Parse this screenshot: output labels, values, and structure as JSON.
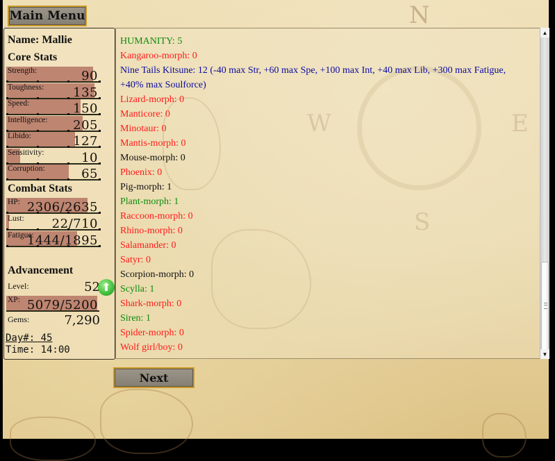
{
  "buttons": {
    "main_menu": "Main Menu",
    "next": "Next"
  },
  "compass": {
    "n": "N",
    "w": "W",
    "e": "E",
    "s": "S"
  },
  "player": {
    "name_label": "Name: Mallie"
  },
  "core_stats": {
    "heading": "Core Stats",
    "items": [
      {
        "label": "Strength:",
        "value": "90",
        "fill": 0.93
      },
      {
        "label": "Toughness:",
        "value": "135",
        "fill": 0.95
      },
      {
        "label": "Speed:",
        "value": "150",
        "fill": 0.8
      },
      {
        "label": "Intelligence:",
        "value": "205",
        "fill": 0.82
      },
      {
        "label": "Libido:",
        "value": "127",
        "fill": 0.74
      },
      {
        "label": "Sensitivity:",
        "value": "10",
        "fill": 0.15
      },
      {
        "label": "Corruption:",
        "value": "65",
        "fill": 0.67
      }
    ]
  },
  "combat_stats": {
    "heading": "Combat Stats",
    "items": [
      {
        "label": "HP:",
        "value": "2306/2635",
        "fill": 0.875
      },
      {
        "label": "Lust:",
        "value": "22/710",
        "fill": 0.03
      },
      {
        "label": "Fatigue:",
        "value": "1444/1895",
        "fill": 0.76
      }
    ]
  },
  "advancement": {
    "heading": "Advancement",
    "level_label": "Level:",
    "level_value": "52",
    "level_up_icon": "arrow-up",
    "xp_label": "XP:",
    "xp_value": "5079/5200",
    "xp_fill": 0.98,
    "gems_label": "Gems:",
    "gems_value": "7,290"
  },
  "time": {
    "day": "Day#: 45",
    "time": "Time: 14:00"
  },
  "colors": {
    "good": "#0d8b0d",
    "bad": "#ff1a1a",
    "info": "#0a0aa0",
    "neutral": "#111111",
    "bar_fill": "#b87b68"
  },
  "main_text": {
    "lines": [
      {
        "text": "HUMANITY: 5",
        "tone": "green"
      },
      {
        "text": "Kangaroo-morph: 0",
        "tone": "red"
      },
      {
        "text": "Nine Tails Kitsune: 12 (-40 max Str, +60 max Spe, +100 max Int, +40 max Lib, +300 max Fatigue, +40% max Soulforce)",
        "tone": "blue"
      },
      {
        "text": "Lizard-morph: 0",
        "tone": "red"
      },
      {
        "text": "Manticore: 0",
        "tone": "red"
      },
      {
        "text": "Minotaur: 0",
        "tone": "red"
      },
      {
        "text": "Mantis-morph: 0",
        "tone": "red"
      },
      {
        "text": "Mouse-morph: 0",
        "tone": "black"
      },
      {
        "text": "Phoenix: 0",
        "tone": "red"
      },
      {
        "text": "Pig-morph: 1",
        "tone": "black"
      },
      {
        "text": "Plant-morph: 1",
        "tone": "green"
      },
      {
        "text": "Raccoon-morph: 0",
        "tone": "red"
      },
      {
        "text": "Rhino-morph: 0",
        "tone": "red"
      },
      {
        "text": "Salamander: 0",
        "tone": "red"
      },
      {
        "text": "Satyr: 0",
        "tone": "red"
      },
      {
        "text": "Scorpion-morph: 0",
        "tone": "black"
      },
      {
        "text": "Scylla: 1",
        "tone": "green"
      },
      {
        "text": "Shark-morph: 0",
        "tone": "red"
      },
      {
        "text": "Siren: 1",
        "tone": "green"
      },
      {
        "text": "Spider-morph: 0",
        "tone": "red"
      },
      {
        "text": "Wolf girl/boy: 0",
        "tone": "red"
      }
    ]
  },
  "scrollbar": {
    "position": 0.72,
    "up_icon": "▲",
    "down_icon": "▼"
  }
}
